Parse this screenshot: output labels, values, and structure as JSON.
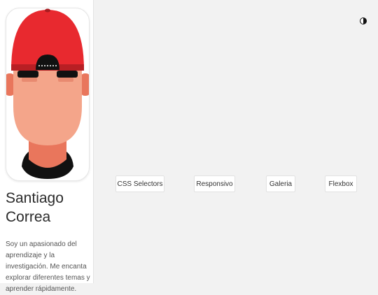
{
  "profile": {
    "first_name": "Santiago",
    "last_name": "Correa",
    "bio": "Soy un apasionado del aprendizaje y la investigación. Me encanta explorar diferentes temas y aprender rápidamente."
  },
  "theme_toggle": {
    "icon": "half-circle-icon"
  },
  "nav": {
    "buttons": [
      "CSS Selectors",
      "Responsivo",
      "Galeria",
      "Flexbox"
    ]
  },
  "colors": {
    "cap": "#e8292f",
    "skin": "#f4a58a",
    "neck": "#e9765c",
    "background": "#f2f2f2"
  }
}
